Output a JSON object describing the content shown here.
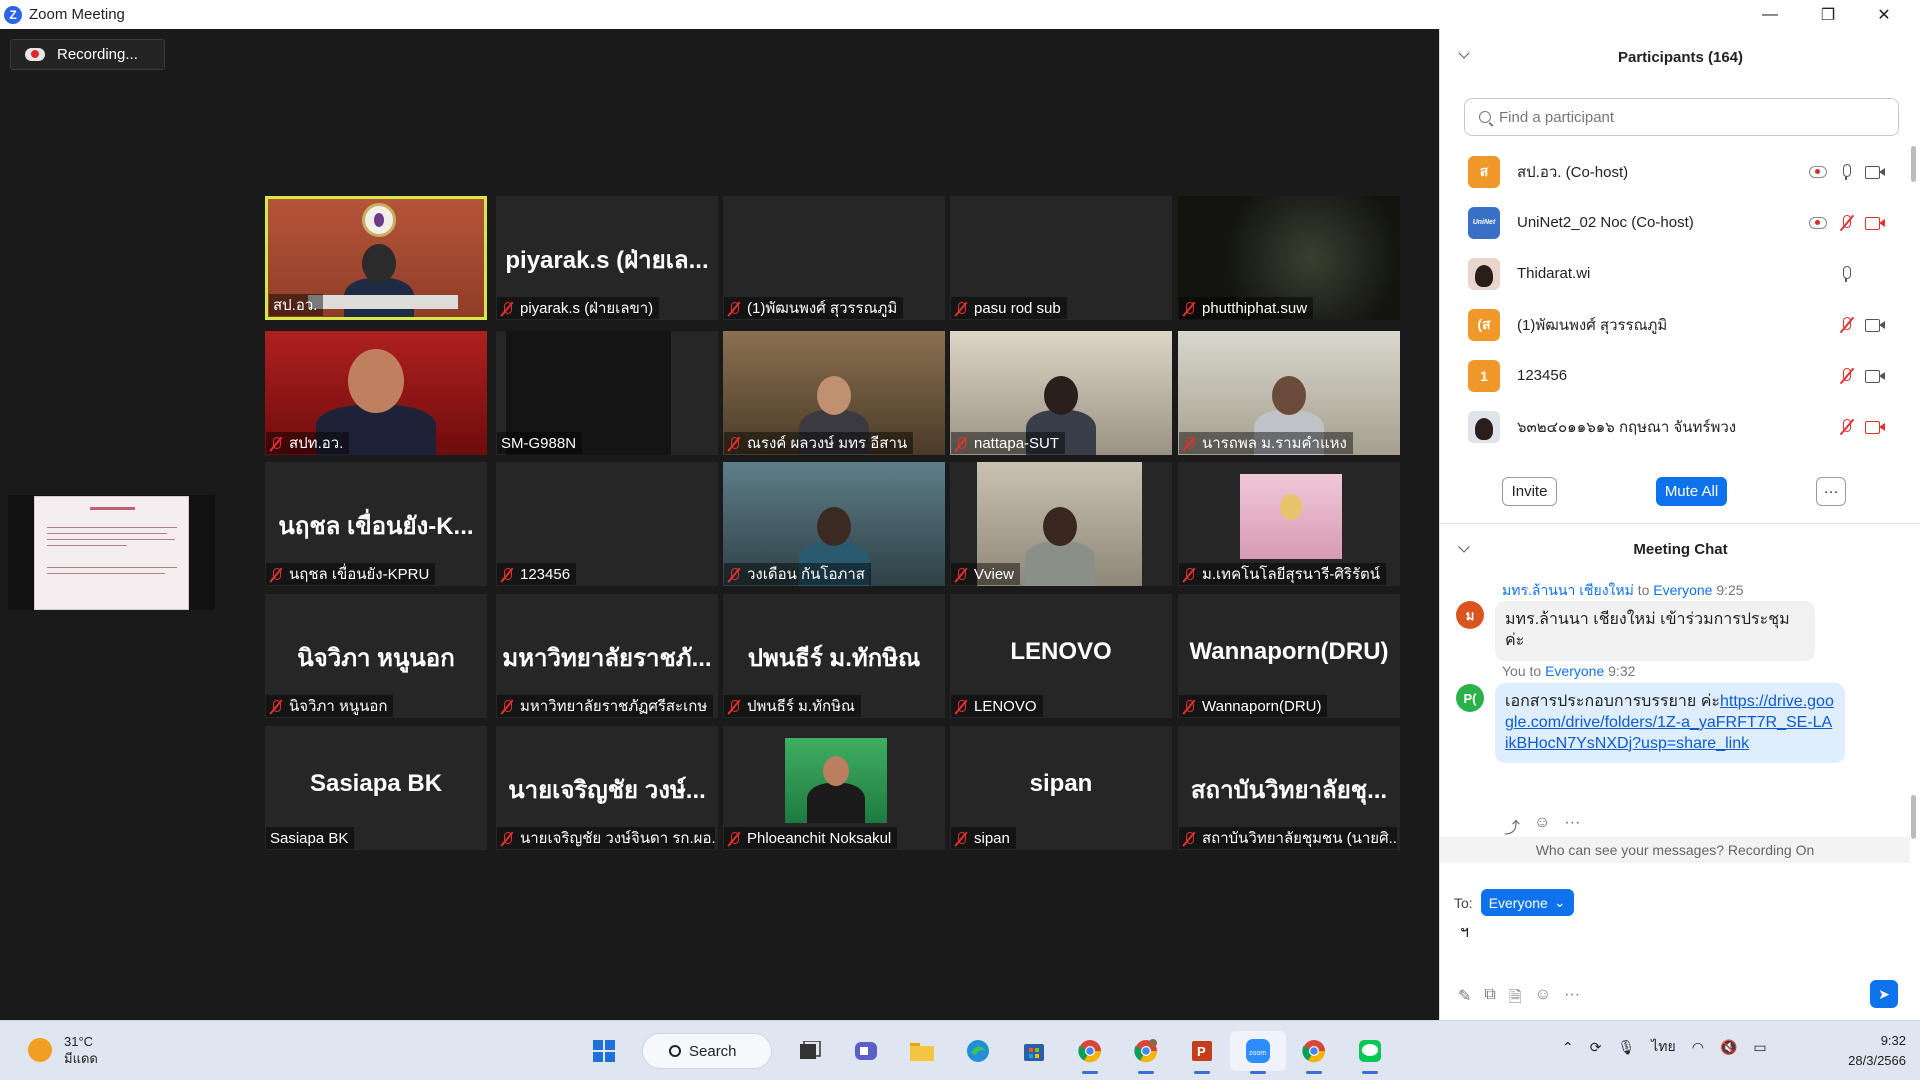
{
  "window": {
    "title": "Zoom Meeting",
    "controls": {
      "minimize": "—",
      "maximize": "❐",
      "close": "✕"
    }
  },
  "recording": {
    "label": "Recording..."
  },
  "gallery": {
    "tiles": [
      {
        "name": "สป.อว.",
        "big": "",
        "video": true,
        "muted": false,
        "active": true
      },
      {
        "name": "piyarak.s (ฝ่ายเลขา)",
        "big": "piyarak.s (ฝ่ายเล...",
        "video": false,
        "muted": true
      },
      {
        "name": "(1)พัฒนพงศ์ สุวรรณภูมิ",
        "big": "",
        "video": false,
        "muted": true
      },
      {
        "name": "pasu rod sub",
        "big": "",
        "video": false,
        "muted": true
      },
      {
        "name": "phutthiphat.suw",
        "big": "",
        "video": true,
        "muted": true
      },
      {
        "name": "สปท.อว.",
        "big": "",
        "video": true,
        "muted": true
      },
      {
        "name": "SM-G988N",
        "big": "",
        "video": true,
        "muted": false
      },
      {
        "name": "ณรงค์ ผลวงษ์ มทร อีสาน",
        "big": "",
        "video": true,
        "muted": true
      },
      {
        "name": "nattapa-SUT",
        "big": "",
        "video": true,
        "muted": true
      },
      {
        "name": "นารถพล ม.รามคำแหง",
        "big": "",
        "video": true,
        "muted": true
      },
      {
        "name": "นฤชล เขื่อนยัง-KPRU",
        "big": "นฤชล เขื่อนยัง-K...",
        "video": false,
        "muted": true
      },
      {
        "name": "123456",
        "big": "",
        "video": false,
        "muted": true
      },
      {
        "name": "วงเดือน กันโอภาส",
        "big": "",
        "video": true,
        "muted": true
      },
      {
        "name": "Vview",
        "big": "",
        "video": true,
        "muted": true
      },
      {
        "name": "ม.เทคโนโลยีสุรนารี-ศิริรัตน์",
        "big": "",
        "video": true,
        "muted": true
      },
      {
        "name": "นิจวิภา หนูนอก",
        "big": "นิจวิภา หนูนอก",
        "video": false,
        "muted": true
      },
      {
        "name": "มหาวิทยาลัยราชภัฏศรีสะเกษ",
        "big": "มหาวิทยาลัยราชภั...",
        "video": false,
        "muted": true
      },
      {
        "name": "ปพนธีร์ ม.ทักษิณ",
        "big": "ปพนธีร์ ม.ทักษิณ",
        "video": false,
        "muted": true
      },
      {
        "name": "LENOVO",
        "big": "LENOVO",
        "video": false,
        "muted": true
      },
      {
        "name": "Wannaporn(DRU)",
        "big": "Wannaporn(DRU)",
        "video": false,
        "muted": true
      },
      {
        "name": "Sasiapa BK",
        "big": "Sasiapa BK",
        "video": false,
        "muted": false
      },
      {
        "name": "นายเจริญชัย วงษ์จินดา รก.ผอ....",
        "big": "นายเจริญชัย วงษ์...",
        "video": false,
        "muted": true
      },
      {
        "name": "Phloeanchit Noksakul",
        "big": "",
        "video": true,
        "muted": true
      },
      {
        "name": "sipan",
        "big": "sipan",
        "video": false,
        "muted": true
      },
      {
        "name": "สถาบันวิทยาลัยชุมชน (นายศิ...",
        "big": "สถาบันวิทยาลัยชุ...",
        "video": false,
        "muted": true
      }
    ]
  },
  "participants": {
    "title": "Participants (164)",
    "search_placeholder": "Find a participant",
    "list": [
      {
        "name": "สป.อว. (Co-host)",
        "avatar": "ส",
        "avatar_color": "#f0982a",
        "rec": true,
        "mic": "on",
        "cam": "on"
      },
      {
        "name": "UniNet2_02 Noc (Co-host)",
        "avatar": "UniNet",
        "avatar_color": "#3a6fc8",
        "rec": true,
        "mic": "muted",
        "cam": "off"
      },
      {
        "name": "Thidarat.wi",
        "avatar": "photo",
        "avatar_color": "#e8d6cc",
        "rec": false,
        "mic": "on",
        "cam": "none"
      },
      {
        "name": "(1)พัฒนพงศ์ สุวรรณภูมิ",
        "avatar": "(ส",
        "avatar_color": "#f0982a",
        "rec": false,
        "mic": "muted",
        "cam": "on"
      },
      {
        "name": "123456",
        "avatar": "1",
        "avatar_color": "#f0982a",
        "rec": false,
        "mic": "muted",
        "cam": "on"
      },
      {
        "name": "๖๓๒๔๐๑๑๖๑๖ กฤษณา จันทร์พวง",
        "avatar": "photo",
        "avatar_color": "#dfe3ea",
        "rec": false,
        "mic": "muted",
        "cam": "off"
      }
    ],
    "invite_label": "Invite",
    "mute_all_label": "Mute All",
    "more_label": "···"
  },
  "chat": {
    "title": "Meeting Chat",
    "messages": [
      {
        "from": "มทร.ล้านนา เชียงใหม่",
        "to_word": "to",
        "to": "Everyone",
        "time": "9:25",
        "avatar": "ม",
        "avatar_color": "#d9541e",
        "text": "มทร.ล้านนา เชียงใหม่ เข้าร่วมการประชุมค่ะ"
      },
      {
        "from": "You",
        "to_word": "to",
        "to": "Everyone",
        "time": "9:32",
        "avatar": "P(",
        "avatar_color": "#2bb14a",
        "text_prefix": "เอกสารประกอบการบรรยาย ค่ะ",
        "link": "https://drive.google.com/drive/folders/1Z-a_yaFRFT7R_SE-LAikBHocN7YsNXDj?usp=share_link"
      }
    ],
    "reactions": [
      "⤴",
      "☺",
      "···"
    ],
    "privacy_note": "Who can see your messages? Recording On",
    "compose": {
      "to_label": "To:",
      "recipient": "Everyone",
      "draft": "ฯ"
    },
    "tools": [
      "✎",
      "⧉",
      "🗎",
      "☺",
      "···"
    ],
    "send_icon": "➤"
  },
  "taskbar": {
    "weather": {
      "temp": "31°C",
      "desc": "มีแดด"
    },
    "search_label": "Search",
    "apps": [
      "windows-start",
      "search",
      "task-view",
      "meet",
      "file-explorer",
      "edge",
      "store",
      "chrome",
      "chrome-profile",
      "powerpoint",
      "zoom",
      "chrome-2",
      "line"
    ],
    "tray": {
      "lang": "ไทย"
    },
    "time": "9:32",
    "date": "28/3/2566"
  }
}
